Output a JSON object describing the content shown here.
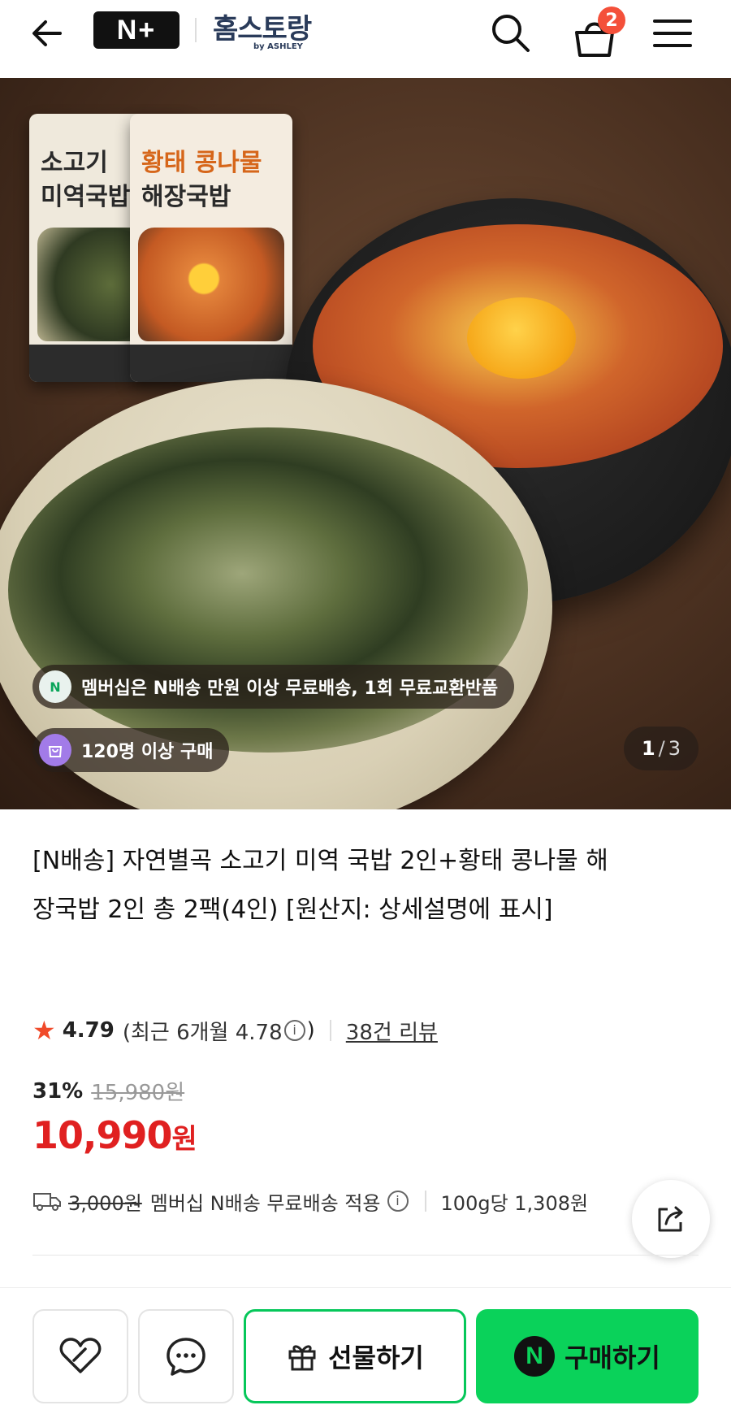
{
  "header": {
    "logo": "N+",
    "brand_name": "홈스토랑",
    "brand_sub": "by ASHLEY",
    "cart_count": "2",
    "icons": [
      "back-arrow-icon",
      "search-icon",
      "cart-icon",
      "menu-icon"
    ]
  },
  "hero": {
    "packs": [
      {
        "title_line1": "소고기",
        "title_line2": "미역국밥"
      },
      {
        "title_line1": "황태 콩나물",
        "title_line2": "해장국밥"
      }
    ],
    "membership_chip": "멤버십은 N배송 만원 이상 무료배송, 1회 무료교환반품",
    "purchase_chip": "120명 이상 구매",
    "pager_current": "1",
    "pager_sep": "/",
    "pager_total": "3"
  },
  "product": {
    "title": "[N배송] 자연별곡 소고기 미역 국밥 2인+황태 콩나물 해장국밥 2인 총 2팩(4인) [원산지: 상세설명에 표시]",
    "rating": "4.79",
    "recent_prefix": "(최근 6개월 4.78",
    "recent_suffix": ")",
    "review_link": "38건 리뷰",
    "discount": "31%",
    "original_price": "15,980원",
    "price": "10,990",
    "price_unit": "원",
    "shipping_old": "3,000원",
    "shipping_text": "멤버십 N배송 무료배송 적용",
    "unit_price": "100g당 1,308원"
  },
  "bottom_bar": {
    "gift_label": "선물하기",
    "buy_label": "구매하기",
    "buy_logo": "N"
  },
  "colors": {
    "accent_green": "#0ad25a",
    "price_red": "#e02020",
    "badge_red": "#f4503a",
    "star": "#f04a2a"
  }
}
